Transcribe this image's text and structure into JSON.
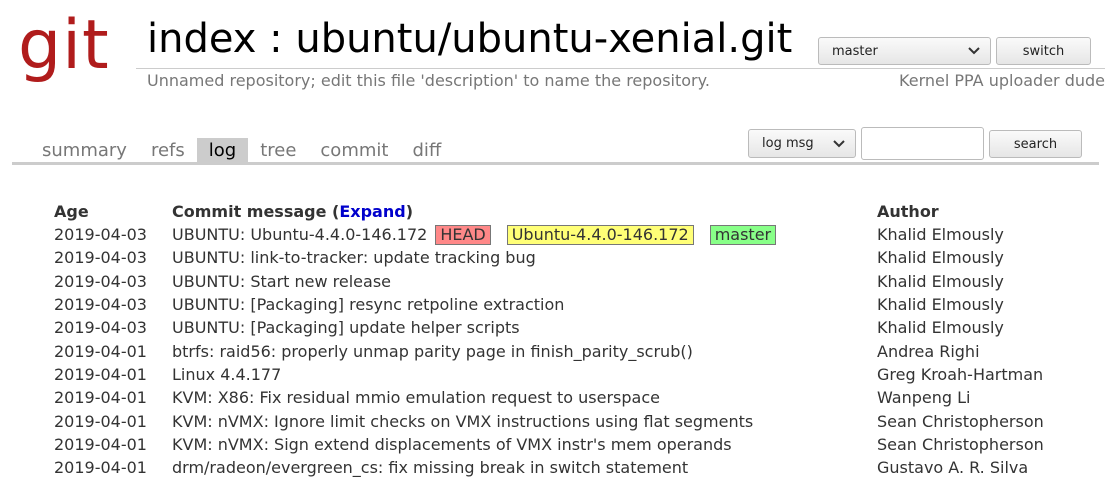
{
  "header": {
    "logo_text": "git",
    "title": "index : ubuntu/ubuntu-xenial.git",
    "description": "Unnamed repository; edit this file 'description' to name the repository.",
    "owner": "Kernel PPA uploader dude",
    "branch_select": {
      "value": "master",
      "icon": "chevron-down-icon"
    },
    "switch_label": "switch"
  },
  "tabs": [
    {
      "label": "summary",
      "active": false
    },
    {
      "label": "refs",
      "active": false
    },
    {
      "label": "log",
      "active": true
    },
    {
      "label": "tree",
      "active": false
    },
    {
      "label": "commit",
      "active": false
    },
    {
      "label": "diff",
      "active": false
    }
  ],
  "search": {
    "mode_select": {
      "value": "log msg",
      "icon": "chevron-down-icon"
    },
    "query_value": "",
    "button_label": "search"
  },
  "log": {
    "columns": {
      "age": "Age",
      "message": "Commit message (",
      "expand": "Expand",
      "message_close": ")",
      "author": "Author"
    },
    "head_commit": {
      "age": "2019-04-03",
      "message": "UBUNTU: Ubuntu-4.4.0-146.172",
      "decorations": {
        "head": "HEAD",
        "tag": "Ubuntu-4.4.0-146.172",
        "branch": "master"
      },
      "author": "Khalid Elmously"
    },
    "rows": [
      {
        "age": "2019-04-03",
        "message": "UBUNTU: link-to-tracker: update tracking bug",
        "author": "Khalid Elmously"
      },
      {
        "age": "2019-04-03",
        "message": "UBUNTU: Start new release",
        "author": "Khalid Elmously"
      },
      {
        "age": "2019-04-03",
        "message": "UBUNTU: [Packaging] resync retpoline extraction",
        "author": "Khalid Elmously"
      },
      {
        "age": "2019-04-03",
        "message": "UBUNTU: [Packaging] update helper scripts",
        "author": "Khalid Elmously"
      },
      {
        "age": "2019-04-01",
        "message": "btrfs: raid56: properly unmap parity page in finish_parity_scrub()",
        "author": "Andrea Righi"
      },
      {
        "age": "2019-04-01",
        "message": "Linux 4.4.177",
        "author": "Greg Kroah-Hartman"
      },
      {
        "age": "2019-04-01",
        "message": "KVM: X86: Fix residual mmio emulation request to userspace",
        "author": "Wanpeng Li"
      },
      {
        "age": "2019-04-01",
        "message": "KVM: nVMX: Ignore limit checks on VMX instructions using flat segments",
        "author": "Sean Christopherson"
      },
      {
        "age": "2019-04-01",
        "message": "KVM: nVMX: Sign extend displacements of VMX instr's mem operands",
        "author": "Sean Christopherson"
      },
      {
        "age": "2019-04-01",
        "message": "drm/radeon/evergreen_cs: fix missing break in switch statement",
        "author": "Gustavo A. R. Silva"
      }
    ]
  }
}
